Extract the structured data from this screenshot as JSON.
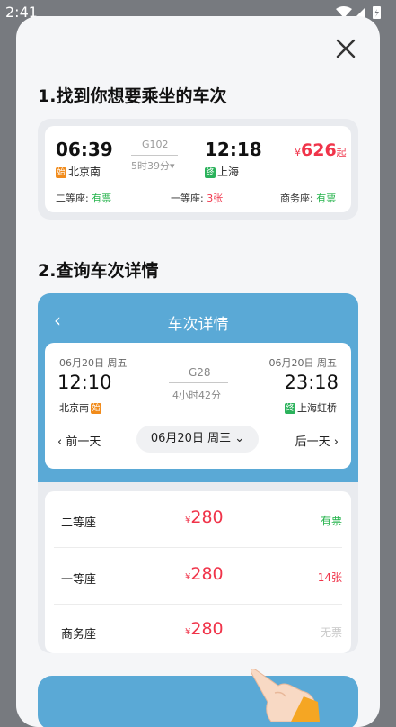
{
  "status": {
    "time": "2:41"
  },
  "step1": {
    "title": "1.找到你想要乘坐的车次"
  },
  "train_card": {
    "depart_time": "06:39",
    "depart_tag": "始",
    "depart_station": "北京南",
    "train_no": "G102",
    "duration": "5时39分",
    "arrive_time": "12:18",
    "arrive_tag": "终",
    "arrive_station": "上海",
    "price_symbol": "¥",
    "price": "626",
    "price_suffix": "起",
    "seats": [
      {
        "label": "二等座:",
        "value": "有票",
        "status": "green"
      },
      {
        "label": "一等座:",
        "value": "3张",
        "status": "red"
      },
      {
        "label": "商务座:",
        "value": "有票",
        "status": "green"
      }
    ]
  },
  "step2": {
    "title": "2.查询车次详情"
  },
  "detail": {
    "back_symbol": "‹",
    "title": "车次详情",
    "depart_date": "06月20日 周五",
    "arrive_date": "06月20日 周五",
    "depart_time": "12:10",
    "arrive_time": "23:18",
    "train_no": "G28",
    "duration": "4小时42分",
    "depart_station": "北京南",
    "depart_tag": "始",
    "arrive_station": "上海虹桥",
    "arrive_tag": "终",
    "prev_day": "前一天",
    "next_day": "后一天",
    "current_date": "06月20日 周三",
    "seats": [
      {
        "name": "二等座",
        "symbol": "¥",
        "price": "280",
        "avail": "有票",
        "status": "green"
      },
      {
        "name": "一等座",
        "symbol": "¥",
        "price": "280",
        "avail": "14张",
        "status": "red"
      },
      {
        "name": "商务座",
        "symbol": "¥",
        "price": "280",
        "avail": "无票",
        "status": "none"
      }
    ]
  },
  "colors": {
    "accent_blue": "#5aa9d6",
    "price_red": "#f0344a",
    "avail_green": "#24b34b"
  }
}
